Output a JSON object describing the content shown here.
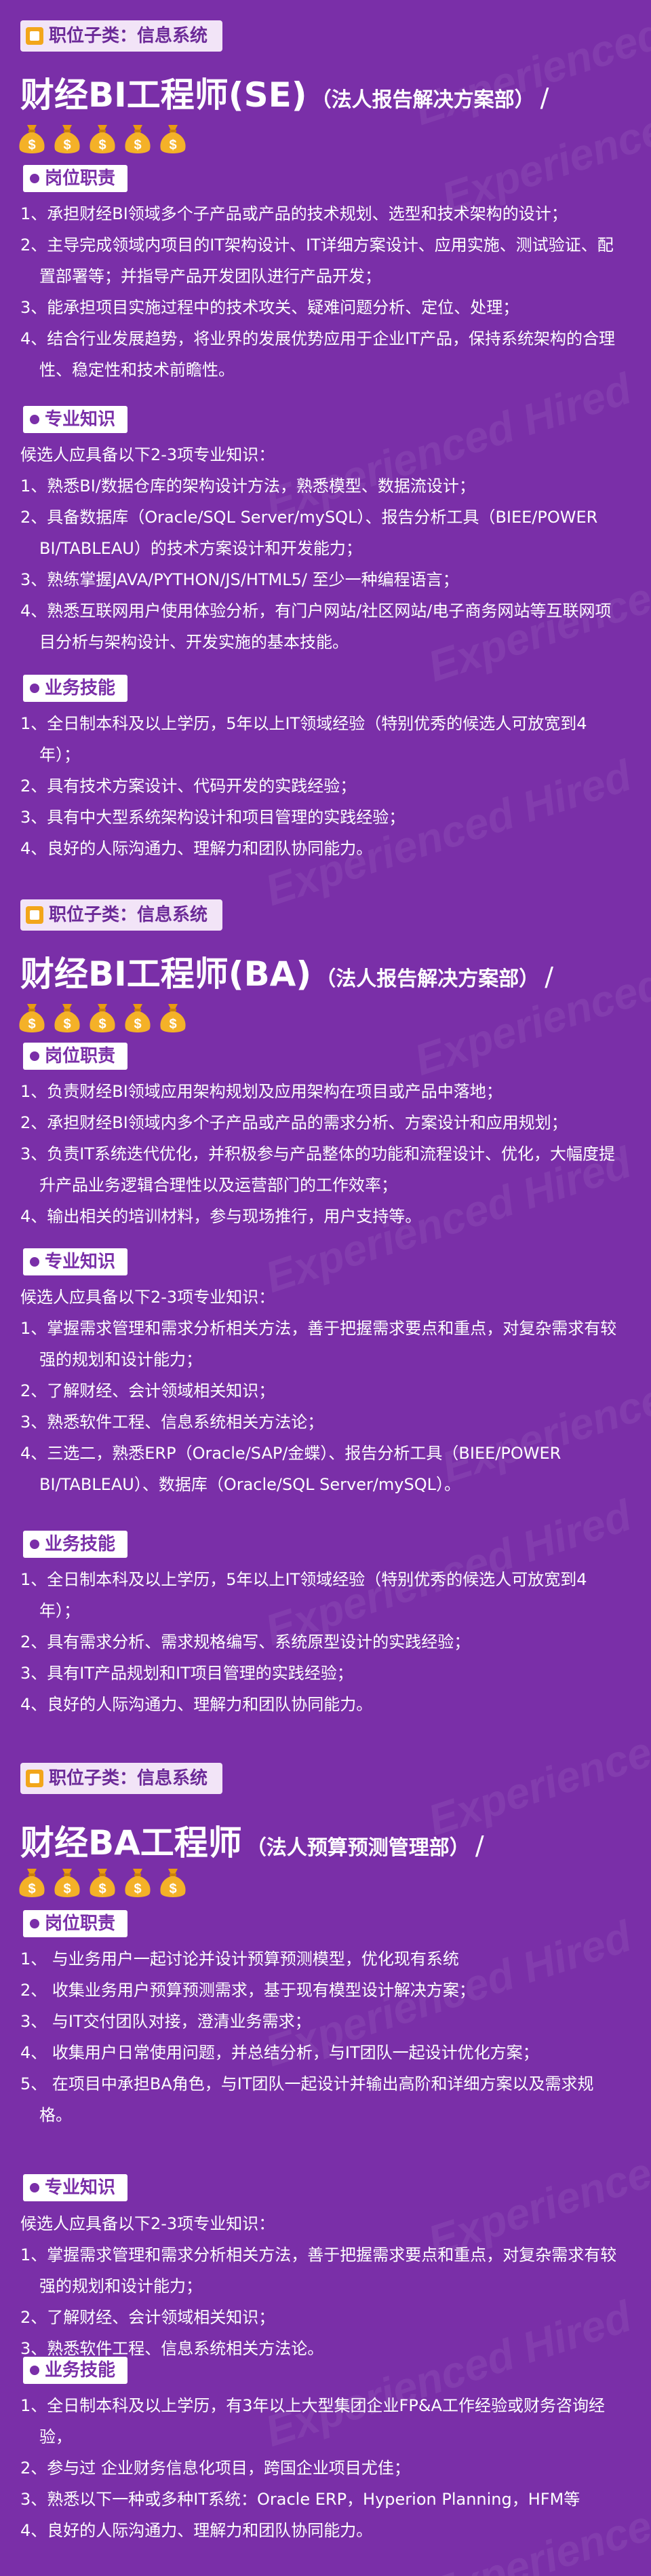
{
  "jobs": [
    {
      "subcategory": "职位子类：信息系统",
      "title": "财经BI工程师(SE)",
      "subtitle": "（法人报告解决方案部）",
      "money_bags": 5,
      "sections": [
        {
          "label": "岗位职责",
          "intro": "",
          "items": [
            "1、承担财经BI领域多个子产品或产品的技术规划、选型和技术架构的设计；",
            "2、主导完成领域内项目的IT架构设计、IT详细方案设计、应用实施、测试验证、配置部署等；并指导产品开发团队进行产品开发；",
            "3、能承担项目实施过程中的技术攻关、疑难问题分析、定位、处理；",
            "4、结合行业发展趋势，将业界的发展优势应用于企业IT产品，保持系统架构的合理性、稳定性和技术前瞻性。"
          ]
        },
        {
          "label": "专业知识",
          "intro": "候选人应具备以下2-3项专业知识：",
          "items": [
            "1、熟悉BI/数据仓库的架构设计方法，熟悉模型、数据流设计；",
            "2、具备数据库（Oracle/SQL Server/mySQL）、报告分析工具（BIEE/POWER BI/TABLEAU）的技术方案设计和开发能力；",
            "3、熟练掌握JAVA/PYTHON/JS/HTML5/ 至少一种编程语言；",
            "4、熟悉互联网用户使用体验分析，有门户网站/社区网站/电子商务网站等互联网项目分析与架构设计、开发实施的基本技能。"
          ]
        },
        {
          "label": "业务技能",
          "intro": "",
          "items": [
            "1、全日制本科及以上学历，5年以上IT领域经验（特别优秀的候选人可放宽到4年）；",
            "2、具有技术方案设计、代码开发的实践经验；",
            "3、具有中大型系统架构设计和项目管理的实践经验；",
            "4、良好的人际沟通力、理解力和团队协同能力。"
          ]
        }
      ]
    },
    {
      "subcategory": "职位子类：信息系统",
      "title": "财经BI工程师(BA)",
      "subtitle": "（法人报告解决方案部）",
      "money_bags": 5,
      "sections": [
        {
          "label": "岗位职责",
          "intro": "",
          "items": [
            "1、负责财经BI领域应用架构规划及应用架构在项目或产品中落地；",
            "2、承担财经BI领域内多个子产品或产品的需求分析、方案设计和应用规划；",
            "3、负责IT系统迭代优化，并积极参与产品整体的功能和流程设计、优化，大幅度提升产品业务逻辑合理性以及运营部门的工作效率；",
            "4、输出相关的培训材料，参与现场推行，用户支持等。"
          ]
        },
        {
          "label": "专业知识",
          "intro": "候选人应具备以下2-3项专业知识：",
          "items": [
            "1、掌握需求管理和需求分析相关方法，善于把握需求要点和重点，对复杂需求有较强的规划和设计能力；",
            "2、了解财经、会计领域相关知识；",
            "3、熟悉软件工程、信息系统相关方法论；",
            "4、三选二，熟悉ERP（Oracle/SAP/金蝶）、报告分析工具（BIEE/POWER BI/TABLEAU）、数据库（Oracle/SQL Server/mySQL）。"
          ]
        },
        {
          "label": "业务技能",
          "intro": "",
          "items": [
            "1、全日制本科及以上学历，5年以上IT领域经验（特别优秀的候选人可放宽到4年）；",
            "2、具有需求分析、需求规格编写、系统原型设计的实践经验；",
            "3、具有IT产品规划和IT项目管理的实践经验；",
            "4、良好的人际沟通力、理解力和团队协同能力。"
          ]
        }
      ]
    },
    {
      "subcategory": "职位子类：信息系统",
      "title": "财经BA工程师",
      "subtitle": "（法人预算预测管理部）",
      "money_bags": 5,
      "sections": [
        {
          "label": "岗位职责",
          "intro": "",
          "items": [
            "1、 与业务用户一起讨论并设计预算预测模型，优化现有系统",
            "2、 收集业务用户预算预测需求，基于现有模型设计解决方案；",
            "3、 与IT交付团队对接，澄清业务需求；",
            "4、 收集用户日常使用问题，并总结分析，与IT团队一起设计优化方案；",
            "5、 在项目中承担BA角色，与IT团队一起设计并输出高阶和详细方案以及需求规格。"
          ]
        },
        {
          "label": "专业知识",
          "intro": "候选人应具备以下2-3项专业知识：",
          "items": [
            "1、掌握需求管理和需求分析相关方法，善于把握需求要点和重点，对复杂需求有较强的规划和设计能力；",
            "2、了解财经、会计领域相关知识；",
            "3、熟悉软件工程、信息系统相关方法论。"
          ]
        },
        {
          "label": "业务技能",
          "intro": "",
          "items": [
            "1、全日制本科及以上学历，有3年以上大型集团企业FP&A工作经验或财务咨询经验，",
            "2、参与过 企业财务信息化项目，跨国企业项目尤佳；",
            "3、熟悉以下一种或多种IT系统：Oracle ERP，Hyperion Planning，HFM等",
            "4、良好的人际沟通力、理解力和团队协同能力。"
          ]
        }
      ]
    }
  ],
  "watermark": "Experienced Hired",
  "colors": {
    "background": "#7a2fa8",
    "label_bg": "#ffffff",
    "subcat_bg": "#f2e4f7",
    "accent": "#f2a61b"
  }
}
